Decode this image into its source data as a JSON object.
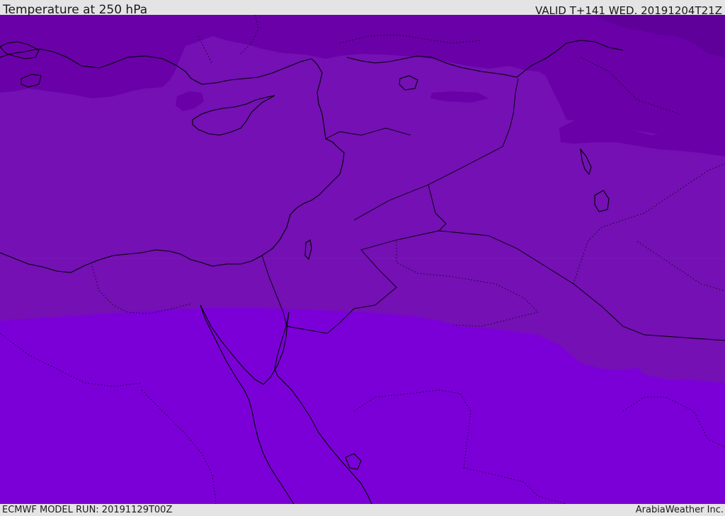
{
  "header": {
    "title": "Temperature at 250 hPa",
    "valid_time": "VALID T+141 WED. 20191204T21Z"
  },
  "footer": {
    "model_run": "ECMWF MODEL RUN: 20191129T00Z",
    "credit": "ArabiaWeather Inc."
  },
  "colors": {
    "band_coldest": "#5e0099",
    "band_cold": "#6a00a8",
    "band_mid": "#7410b4",
    "band_warm": "#7b00d8",
    "coastline": "#000000",
    "header_bg": "#e4e4e4"
  }
}
